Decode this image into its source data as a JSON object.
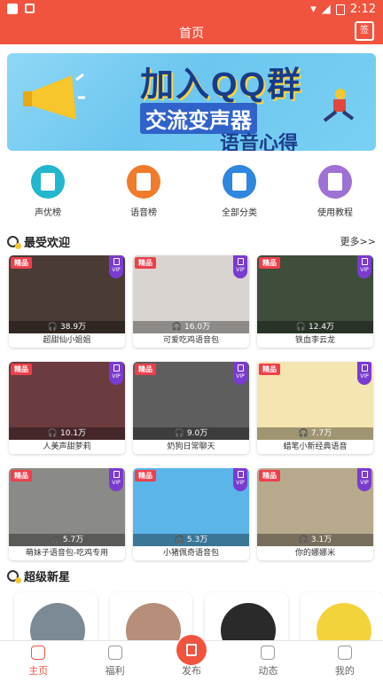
{
  "status_bar": {
    "time": "2:12"
  },
  "app_bar": {
    "title": "首页",
    "calendar_label": "签"
  },
  "banner": {
    "line1": "加入QQ群",
    "line2": "交流变声器",
    "line3": "语音心得"
  },
  "categories": [
    {
      "label": "声优榜",
      "icon": "document-icon",
      "color": "#22b6cf"
    },
    {
      "label": "语音榜",
      "icon": "document-icon",
      "color": "#f07b2b"
    },
    {
      "label": "全部分类",
      "icon": "list-icon",
      "color": "#2e86de"
    },
    {
      "label": "使用教程",
      "icon": "book-icon",
      "color": "#9d71d6"
    }
  ],
  "popular": {
    "title": "最受欢迎",
    "more": "更多>>",
    "badge": "精品",
    "vip": "VIP",
    "items": [
      {
        "name": "超甜仙小姐姐",
        "plays": "38.9万",
        "thumb_color": "#4a3b35"
      },
      {
        "name": "可爱吃鸡语音包",
        "plays": "16.0万",
        "thumb_color": "#d9d4d0"
      },
      {
        "name": "铁血李云龙",
        "plays": "12.4万",
        "thumb_color": "#3f4d3b"
      },
      {
        "name": "人美声甜萝莉",
        "plays": "10.1万",
        "thumb_color": "#6b3b3f"
      },
      {
        "name": "奶狗日常聊天",
        "plays": "9.0万",
        "thumb_color": "#5e5e5e"
      },
      {
        "name": "蜡笔小新经典语音",
        "plays": "7.7万",
        "thumb_color": "#f5e5b0"
      },
      {
        "name": "萌妹子语音包-吃鸡专用",
        "plays": "5.7万",
        "thumb_color": "#8a8a86"
      },
      {
        "name": "小猪佩奇语音包",
        "plays": "5.3万",
        "thumb_color": "#5bb5e8"
      },
      {
        "name": "你的娜娜米",
        "plays": "3.1万",
        "thumb_color": "#b7a98c"
      }
    ]
  },
  "new_stars": {
    "title": "超级新星",
    "avatars": [
      "#7b8a95",
      "#b78e7a",
      "#2a2a2a",
      "#f3d33b"
    ]
  },
  "tabs": [
    {
      "label": "主页",
      "active": true
    },
    {
      "label": "福利",
      "active": false
    },
    {
      "label": "发布",
      "active": false
    },
    {
      "label": "动态",
      "active": false
    },
    {
      "label": "我的",
      "active": false
    }
  ]
}
